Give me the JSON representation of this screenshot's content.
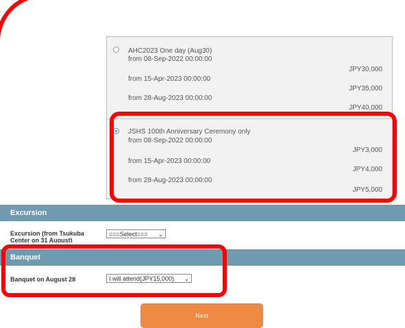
{
  "options": [
    {
      "title": "AHC2023 One day (Aug30)",
      "selected": false,
      "tiers": [
        {
          "from": "from 08-Sep-2022 00:00:00",
          "price": "JPY30,000"
        },
        {
          "from": "from 15-Apr-2023 00:00:00",
          "price": "JPY35,000"
        },
        {
          "from": "from 28-Aug-2023 00:00:00",
          "price": "JPY40,000"
        }
      ]
    },
    {
      "title": "JSHS 100th Anniversary Ceremony only",
      "selected": true,
      "tiers": [
        {
          "from": "from 08-Sep-2022 00:00:00",
          "price": "JPY3,000"
        },
        {
          "from": "from 15-Apr-2023 00:00:00",
          "price": "JPY4,000"
        },
        {
          "from": "from 28-Aug-2023 00:00:00",
          "price": "JPY5,000"
        }
      ]
    }
  ],
  "excursion": {
    "heading": "Excursion",
    "label_line1": "Excursion (from Tsukuba",
    "label_line2": "Center on 31 August)",
    "select_value": "===Select==="
  },
  "banquet": {
    "heading": "Banquet",
    "label": "Banquet on August 28",
    "select_value": "I will attend(JPY15,000)"
  },
  "next_label": "Next",
  "colors": {
    "section_header": "#6f9ab0",
    "next_button": "#ef8a45",
    "annotation": "#ff0000"
  }
}
